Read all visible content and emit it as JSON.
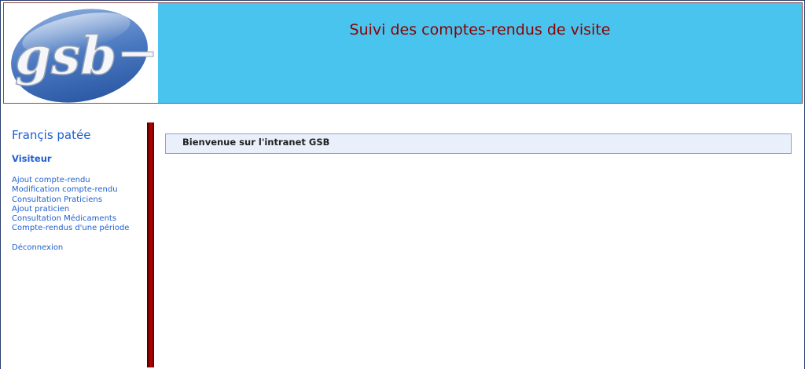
{
  "header": {
    "logo_text": "gsb",
    "title": "Suivi des comptes-rendus de visite"
  },
  "sidebar": {
    "user_name": "Françis patée",
    "role": "Visiteur",
    "menu": [
      {
        "label": "Ajout compte-rendu"
      },
      {
        "label": "Modification compte-rendu"
      },
      {
        "label": "Consultation Praticiens"
      },
      {
        "label": "Ajout praticien"
      },
      {
        "label": "Consultation Médicaments"
      },
      {
        "label": "Compte-rendus d'une période"
      }
    ],
    "logout": "Déconnexion"
  },
  "main": {
    "welcome": "Bienvenue sur l'intranet GSB"
  },
  "colors": {
    "header_bg": "#48c4ee",
    "title": "#8b0000",
    "link": "#1f5fcf",
    "divider": "#a00000",
    "welcome_bg": "#e9f0fb"
  }
}
